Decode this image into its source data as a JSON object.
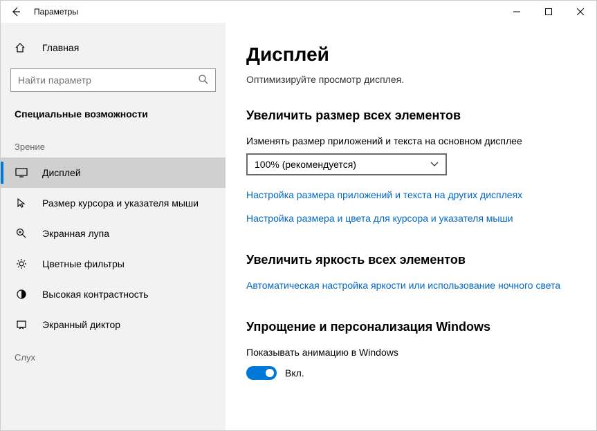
{
  "titlebar": {
    "app_name": "Параметры"
  },
  "sidebar": {
    "home": "Главная",
    "search_placeholder": "Найти параметр",
    "category": "Специальные возможности",
    "group_vision": "Зрение",
    "group_hearing": "Слух",
    "items": [
      {
        "label": "Дисплей"
      },
      {
        "label": "Размер курсора и указателя мыши"
      },
      {
        "label": "Экранная лупа"
      },
      {
        "label": "Цветные фильтры"
      },
      {
        "label": "Высокая контрастность"
      },
      {
        "label": "Экранный диктор"
      }
    ]
  },
  "main": {
    "title": "Дисплей",
    "subtitle": "Оптимизируйте просмотр дисплея.",
    "section1_title": "Увеличить размер всех элементов",
    "scale_label": "Изменять размер приложений и текста на основном дисплее",
    "scale_value": "100% (рекомендуется)",
    "link1": "Настройка размера приложений и текста на других дисплеях",
    "link2": "Настройка размера и цвета для курсора и указателя мыши",
    "section2_title": "Увеличить яркость всех элементов",
    "link3": "Автоматическая настройка яркости или использование ночного света",
    "section3_title": "Упрощение и персонализация Windows",
    "toggle1_label": "Показывать анимацию в Windows",
    "toggle1_state": "Вкл."
  }
}
